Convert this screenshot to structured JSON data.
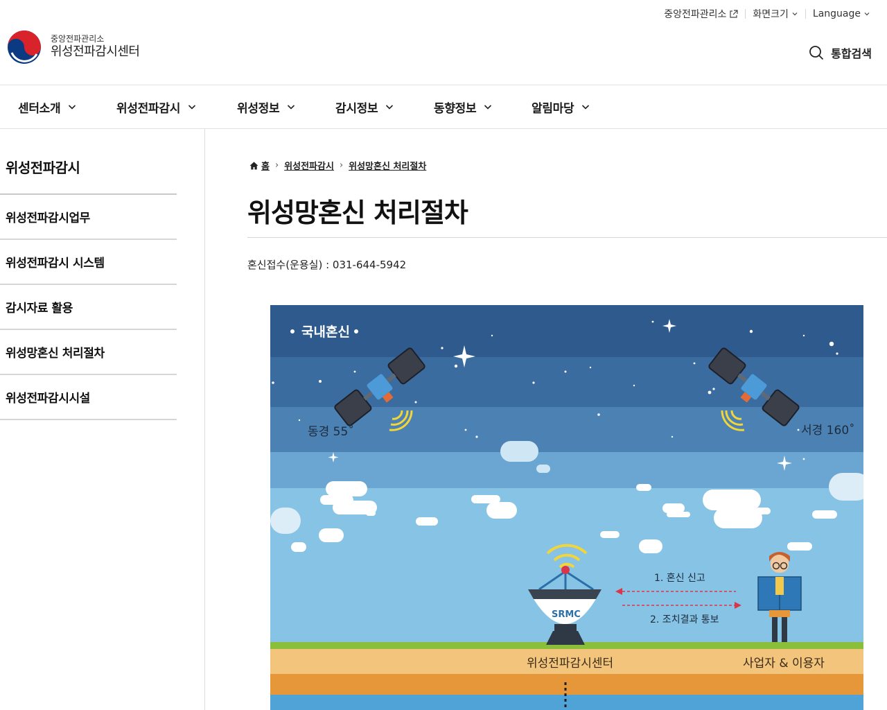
{
  "utility": {
    "items": [
      {
        "label": "중앙전파관리소"
      },
      {
        "label": "화면크기"
      },
      {
        "label": "Language"
      }
    ]
  },
  "logo": {
    "org": "중앙전파관리소",
    "name": "위성전파감시센터"
  },
  "search": {
    "label": "통합검색"
  },
  "gnb": {
    "items": [
      {
        "label": "센터소개"
      },
      {
        "label": "위성전파감시"
      },
      {
        "label": "위성정보"
      },
      {
        "label": "감시정보"
      },
      {
        "label": "동향정보"
      },
      {
        "label": "알림마당"
      }
    ]
  },
  "lnb": {
    "title": "위성전파감시",
    "items": [
      {
        "label": "위성전파감시업무"
      },
      {
        "label": "위성전파감시 시스템"
      },
      {
        "label": "감시자료 활용"
      },
      {
        "label": "위성망혼신 처리절차"
      },
      {
        "label": "위성전파감시시설"
      }
    ]
  },
  "breadcrumb": {
    "home": "홈",
    "level1": "위성전파감시",
    "level2": "위성망혼신 처리절차"
  },
  "page": {
    "title": "위성망혼신 처리절차",
    "contact": "혼신접수(운용실) : 031-644-5942"
  },
  "illustration": {
    "section_label": "국내혼신",
    "east_label": "동경 55˚",
    "west_label": "서경 160˚",
    "step1": "1. 혼신 신고",
    "step2": "2. 조치결과 통보",
    "antenna_logo": "SRMC",
    "left_caption": "위성전파감시센터",
    "right_caption": "사업자 & 이용자",
    "colors": {
      "sky_top": "#2f5a8e",
      "sky_low": "#86c6e6",
      "ground": "#f3c47b",
      "ground_dark": "#e5973a",
      "arrow": "#d9364a"
    }
  }
}
